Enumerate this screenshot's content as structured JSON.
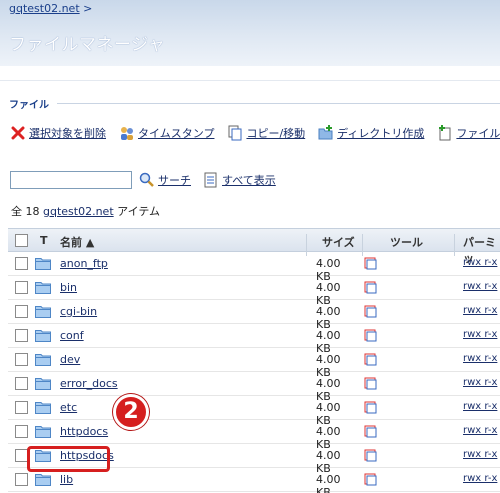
{
  "header": {
    "breadcrumb": "gqtest02.net",
    "breadcrumb_sep": ">",
    "title": "ファイルマネージャ"
  },
  "section": {
    "label": "ファイル"
  },
  "toolbar": {
    "delete_label": "選択対象を削除",
    "timestamp_label": "タイムスタンプ",
    "copy_move_label": "コピー/移動",
    "mkdir_label": "ディレクトリ作成",
    "mkfile_label": "ファイル作成"
  },
  "search": {
    "value": "",
    "search_label": "サーチ",
    "show_all_label": "すべて表示"
  },
  "summary": {
    "prefix": "全 18",
    "domain": "gqtest02.net",
    "suffix": "アイテム"
  },
  "table": {
    "headers": {
      "type": "T",
      "name": "名前 ▲",
      "size": "サイズ",
      "tools": "ツール",
      "perms": "パーミッ"
    },
    "rows": [
      {
        "name": "anon_ftp",
        "size": "4.00 KB",
        "perm": "rwx r-x"
      },
      {
        "name": "bin",
        "size": "4.00 KB",
        "perm": "rwx r-x"
      },
      {
        "name": "cgi-bin",
        "size": "4.00 KB",
        "perm": "rwx r-x"
      },
      {
        "name": "conf",
        "size": "4.00 KB",
        "perm": "rwx r-x"
      },
      {
        "name": "dev",
        "size": "4.00 KB",
        "perm": "rwx r-x"
      },
      {
        "name": "error_docs",
        "size": "4.00 KB",
        "perm": "rwx r-x"
      },
      {
        "name": "etc",
        "size": "4.00 KB",
        "perm": "rwx r-x"
      },
      {
        "name": "httpdocs",
        "size": "4.00 KB",
        "perm": "rwx r-x"
      },
      {
        "name": "httpsdocs",
        "size": "4.00 KB",
        "perm": "rwx r-x"
      },
      {
        "name": "lib",
        "size": "4.00 KB",
        "perm": "rwx r-x"
      }
    ]
  },
  "annotation": {
    "step_number": "2",
    "color": "#d51f1f"
  },
  "icons": {
    "delete": "red-x-icon",
    "timestamp": "people-icon",
    "copy": "copy-icon",
    "mkdir": "new-folder-icon",
    "mkfile": "new-file-icon",
    "search": "magnifier-icon",
    "show_all": "list-icon",
    "folder": "folder-icon",
    "tool": "edit-icon"
  }
}
